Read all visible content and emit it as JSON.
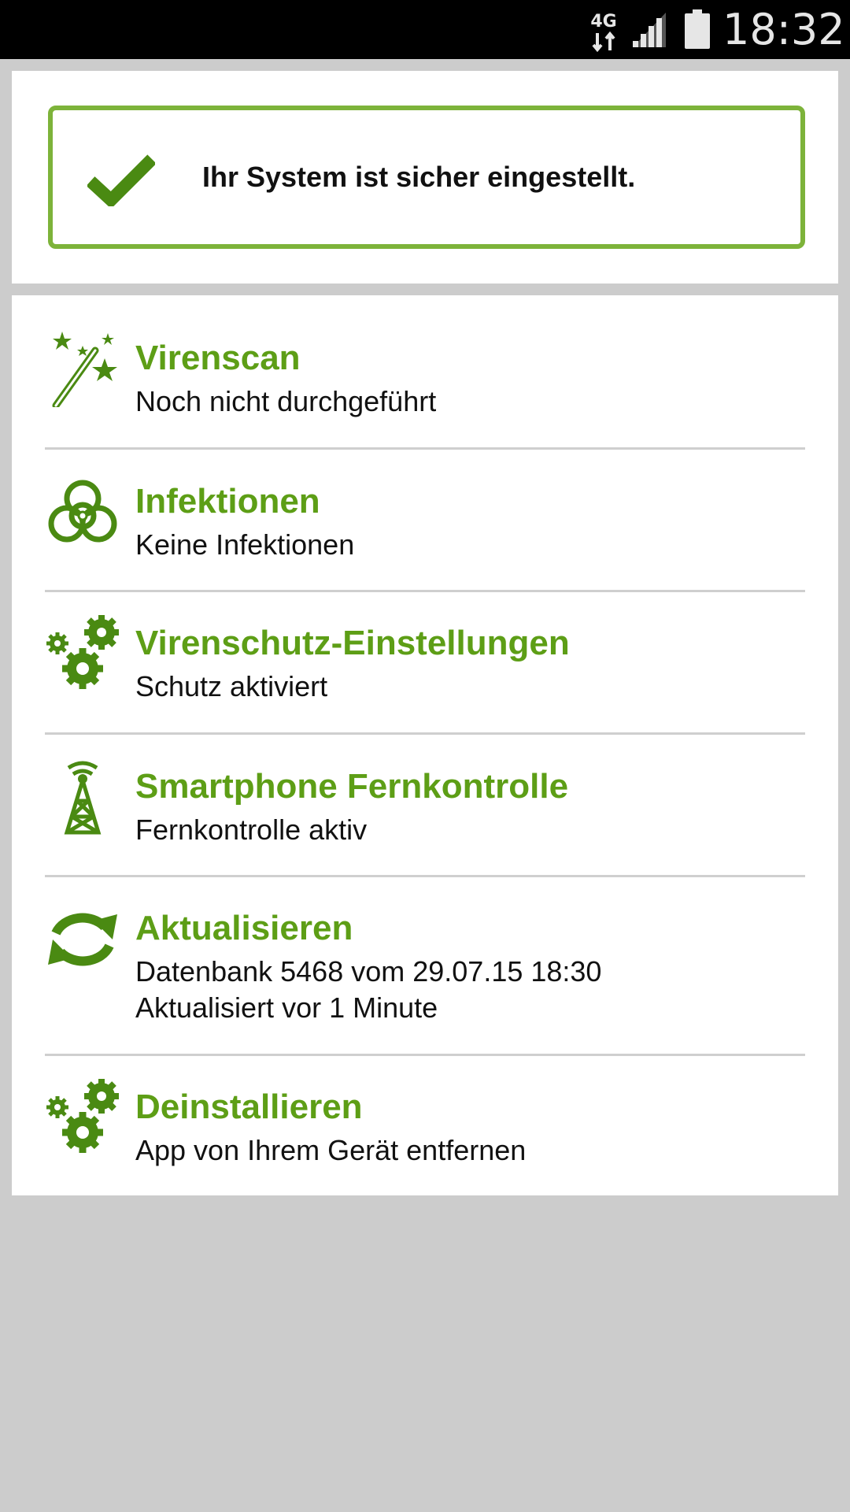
{
  "status_bar": {
    "network": "4G",
    "time": "18:32"
  },
  "status": {
    "message": "Ihr System ist sicher eingestellt.",
    "icon": "checkmark-icon"
  },
  "items": [
    {
      "title": "Virenscan",
      "subtitle": "Noch nicht durchgeführt",
      "icon": "magic-wand-icon"
    },
    {
      "title": "Infektionen",
      "subtitle": "Keine Infektionen",
      "icon": "biohazard-icon"
    },
    {
      "title": "Virenschutz-Einstellungen",
      "subtitle": "Schutz aktiviert",
      "icon": "gears-icon"
    },
    {
      "title": "Smartphone Fernkontrolle",
      "subtitle": "Fernkontrolle aktiv",
      "icon": "antenna-tower-icon"
    },
    {
      "title": "Aktualisieren",
      "subtitle": "Datenbank 5468 vom 29.07.15 18:30",
      "subtitle2": "Aktualisiert vor 1 Minute",
      "icon": "refresh-icon"
    },
    {
      "title": "Deinstallieren",
      "subtitle": "App von Ihrem Gerät entfernen",
      "icon": "gears-icon"
    }
  ],
  "colors": {
    "accent": "#5d9e16",
    "border": "#7db33a",
    "background": "#cccccc"
  }
}
